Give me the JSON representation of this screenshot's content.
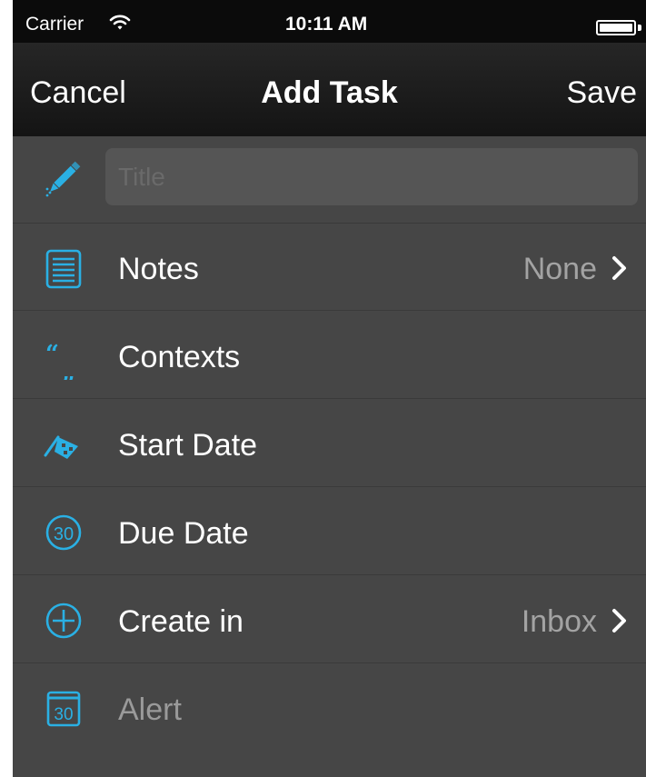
{
  "status_bar": {
    "carrier": "Carrier",
    "time": "10:11 AM",
    "wifi_icon": "wifi-icon",
    "battery_icon": "battery-icon",
    "battery_level": 1.0
  },
  "nav": {
    "cancel": "Cancel",
    "title": "Add Task",
    "save": "Save"
  },
  "title_field": {
    "placeholder": "Title",
    "value": "",
    "icon": "pencil-icon"
  },
  "rows": [
    {
      "label": "Notes",
      "value": "None",
      "icon": "notes-icon",
      "disclosure": true
    },
    {
      "label": "Contexts",
      "value": "",
      "icon": "quote-icon",
      "disclosure": false
    },
    {
      "label": "Start Date",
      "value": "",
      "icon": "flag-icon",
      "disclosure": false
    },
    {
      "label": "Due Date",
      "value": "",
      "icon": "due-date-icon",
      "icon_text": "30",
      "disclosure": false
    },
    {
      "label": "Create in",
      "value": "Inbox",
      "icon": "plus-circle-icon",
      "disclosure": true
    },
    {
      "label": "Alert",
      "value": "",
      "icon": "calendar-icon",
      "icon_text": "30",
      "disclosure": false
    }
  ],
  "colors": {
    "accent": "#2ab0e4",
    "background": "#464646",
    "nav_background": "#141414",
    "status_bar": "#0b0b0b"
  }
}
